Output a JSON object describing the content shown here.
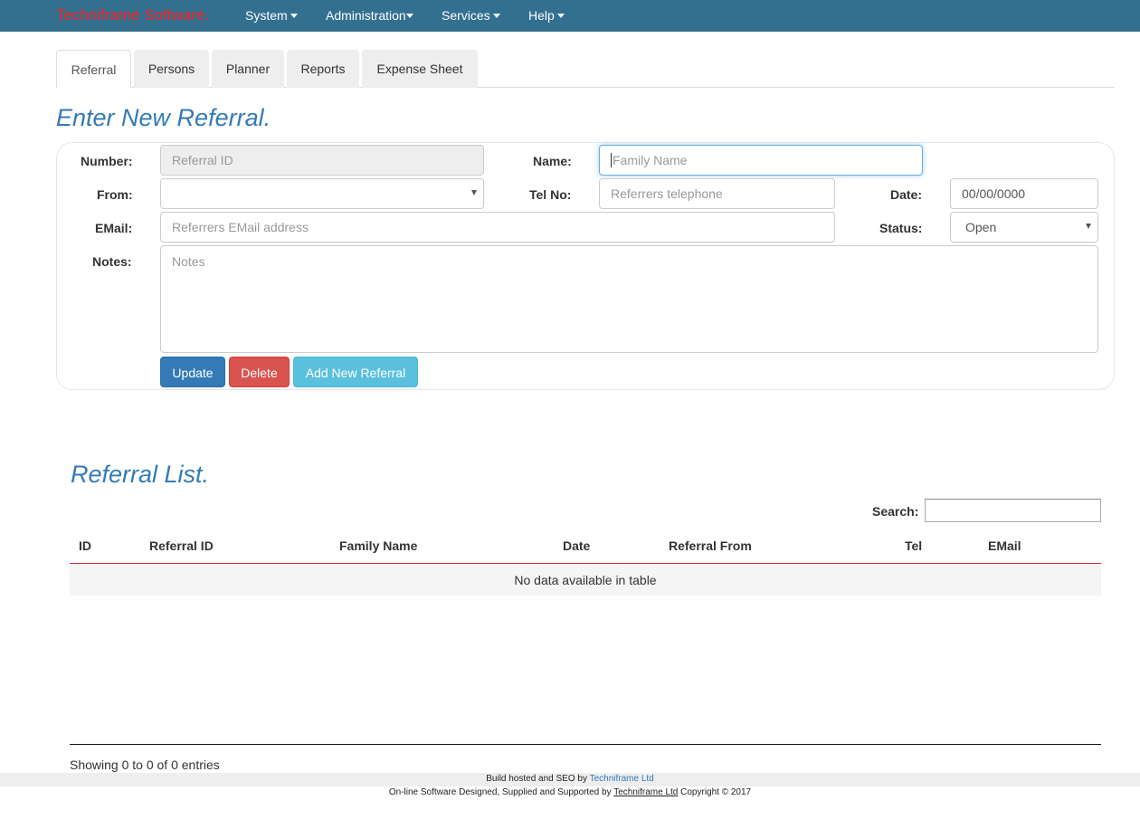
{
  "navbar": {
    "brand": "Techniframe Software.",
    "menus": [
      "System",
      "Administration",
      "Services",
      "Help"
    ]
  },
  "tabs": [
    "Referral",
    "Persons",
    "Planner",
    "Reports",
    "Expense Sheet"
  ],
  "form": {
    "title": "Enter New Referral.",
    "number_label": "Number:",
    "number_placeholder": "Referral ID",
    "name_label": "Name:",
    "name_placeholder": "Family Name",
    "from_label": "From:",
    "from_value": "",
    "tel_label": "Tel No:",
    "tel_placeholder": "Referrers telephone",
    "date_label": "Date:",
    "date_value": "00/00/0000",
    "email_label": "EMail:",
    "email_placeholder": "Referrers EMail address",
    "status_label": "Status:",
    "status_value": "Open",
    "notes_label": "Notes:",
    "notes_placeholder": "Notes",
    "buttons": {
      "update": "Update",
      "delete": "Delete",
      "add": "Add New Referral"
    }
  },
  "list": {
    "title": "Referral List.",
    "search_label": "Search:",
    "columns": [
      "ID",
      "Referral ID",
      "Family Name",
      "Date",
      "Referral From",
      "Tel",
      "EMail"
    ],
    "empty_message": "No data available in table",
    "info": "Showing 0 to 0 of 0 entries"
  },
  "footer": {
    "line1_prefix": "Build hosted and SEO by",
    "line1_link": "Techniframe Ltd",
    "line2_prefix": "On-line Software Designed, Supplied and Supported by",
    "line2_link": "Techniframe Ltd",
    "line2_suffix": "Copyright © 2017"
  },
  "colors": {
    "navbar": "#337090",
    "brand": "#ff2020",
    "primary": "#337ab7",
    "danger": "#d9534f",
    "info": "#5bc0de"
  }
}
